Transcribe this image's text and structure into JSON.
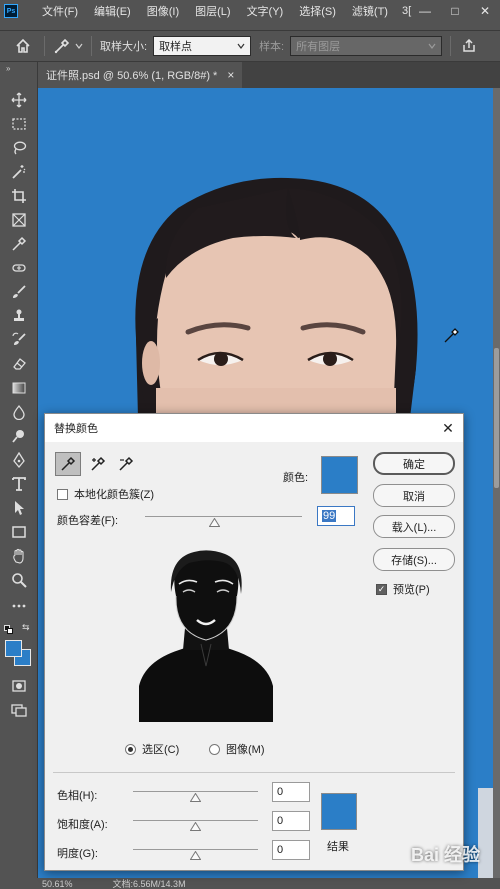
{
  "app": {
    "logo": "Ps"
  },
  "menu": [
    "文件(F)",
    "编辑(E)",
    "图像(I)",
    "图层(L)",
    "文字(Y)",
    "选择(S)",
    "滤镜(T)",
    "3[",
    "—",
    "□",
    "✕"
  ],
  "options_bar": {
    "sample_size_label": "取样大小:",
    "sample_size_value": "取样点",
    "sample_label": "样本:",
    "sample_value": "所有图层"
  },
  "document_tab": {
    "title": "证件照.psd @ 50.6% (1, RGB/8#) *",
    "close": "×"
  },
  "status_bar": {
    "zoom": "50.61%",
    "doc_info": "文档:6.56M/14.3M"
  },
  "dialog": {
    "title": "替换颜色",
    "close": "✕",
    "localized_color_clusters": {
      "label": "本地化颜色簇(Z)",
      "checked": false
    },
    "color_label": "颜色:",
    "fuzziness_label": "颜色容差(F):",
    "fuzziness_value": "99",
    "fuzziness_level_percent": 44,
    "view_selection_label": "选区(C)",
    "view_image_label": "图像(M)",
    "view_selected": "selection",
    "hue_label": "色相(H):",
    "hue_value": "0",
    "saturation_label": "饱和度(A):",
    "saturation_value": "0",
    "lightness_label": "明度(G):",
    "lightness_value": "0",
    "result_label": "结果",
    "buttons": {
      "ok": "确定",
      "cancel": "取消",
      "load": "载入(L)...",
      "save": "存储(S)..."
    },
    "preview": {
      "label": "预览(P)",
      "checked": true
    },
    "colors": {
      "swatch": "#2b7ec7",
      "result": "#2b7ec7"
    }
  },
  "watermark": "Bai 经验"
}
